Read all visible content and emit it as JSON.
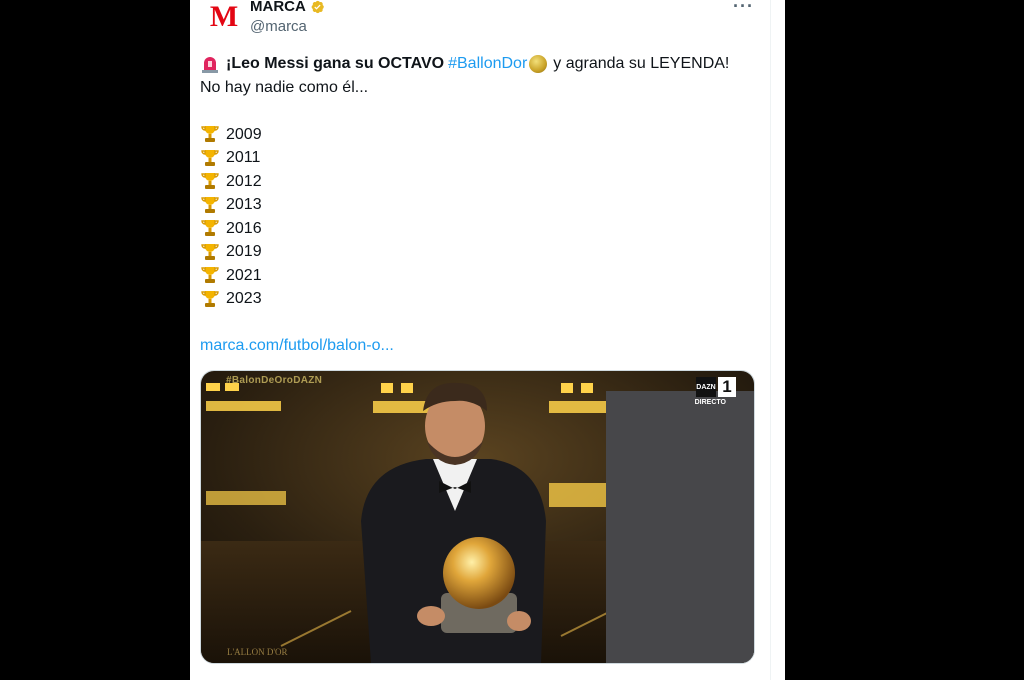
{
  "tweet": {
    "author_name": "MARCA",
    "author_handle": "@marca",
    "avatar_letter": "M",
    "more_label": "···",
    "headline_bold": "¡Leo Messi gana su OCTAVO",
    "hashtag": "#BallonDor",
    "headline_rest": "y agranda su LEYENDA!",
    "subline": "No hay nadie como él...",
    "years": [
      "2009",
      "2011",
      "2012",
      "2013",
      "2016",
      "2019",
      "2021",
      "2023"
    ],
    "link": "marca.com/futbol/balon-o..."
  },
  "media": {
    "overlay_tag": "#BalonDeOroDAZN",
    "broadcaster": "DAZN",
    "channel": "1",
    "live_label": "DIRECTO",
    "event_logo": "L'ALLON D'OR"
  },
  "colors": {
    "link": "#1d9bf0",
    "brand": "#e30613",
    "verified": "#e8b923"
  }
}
